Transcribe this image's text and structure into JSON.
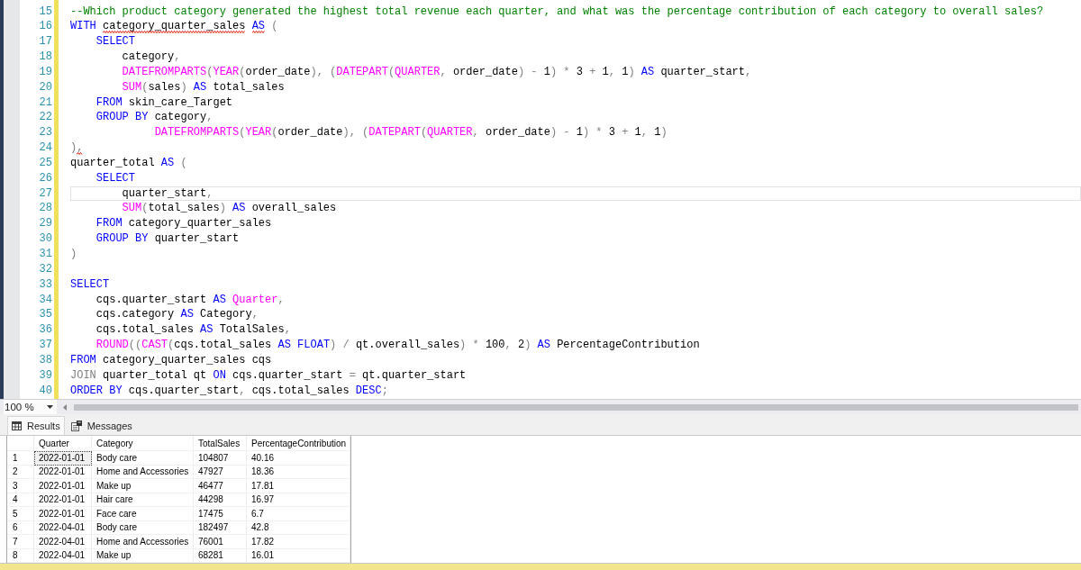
{
  "editor": {
    "lines": [
      {
        "number": "15",
        "current": false,
        "tokens": [
          {
            "kind": "comment",
            "text": "--Which product category generated the highest total revenue each quarter, and what was the percentage contribution of each category to overall sales?"
          }
        ]
      },
      {
        "number": "16",
        "current": false,
        "tokens": [
          {
            "kind": "keyword",
            "text": "WITH "
          },
          {
            "kind": "plain",
            "text": "category_quarter_sales ",
            "error": true
          },
          {
            "kind": "keyword",
            "text": "AS",
            "error": true
          },
          {
            "kind": "operator",
            "text": " ("
          }
        ]
      },
      {
        "number": "17",
        "current": false,
        "tokens": [
          {
            "kind": "keyword",
            "text": "    SELECT"
          }
        ]
      },
      {
        "number": "18",
        "current": false,
        "tokens": [
          {
            "kind": "plain",
            "text": "        category"
          },
          {
            "kind": "operator",
            "text": ","
          }
        ]
      },
      {
        "number": "19",
        "current": false,
        "tokens": [
          {
            "kind": "function",
            "text": "        DATEFROMPARTS"
          },
          {
            "kind": "operator",
            "text": "("
          },
          {
            "kind": "function",
            "text": "YEAR"
          },
          {
            "kind": "operator",
            "text": "("
          },
          {
            "kind": "plain",
            "text": "order_date"
          },
          {
            "kind": "operator",
            "text": "), ("
          },
          {
            "kind": "function",
            "text": "DATEPART"
          },
          {
            "kind": "operator",
            "text": "("
          },
          {
            "kind": "function",
            "text": "QUARTER"
          },
          {
            "kind": "operator",
            "text": ", "
          },
          {
            "kind": "plain",
            "text": "order_date"
          },
          {
            "kind": "operator",
            "text": ") - "
          },
          {
            "kind": "plain",
            "text": "1"
          },
          {
            "kind": "operator",
            "text": ") * "
          },
          {
            "kind": "plain",
            "text": "3"
          },
          {
            "kind": "operator",
            "text": " + "
          },
          {
            "kind": "plain",
            "text": "1"
          },
          {
            "kind": "operator",
            "text": ", "
          },
          {
            "kind": "plain",
            "text": "1"
          },
          {
            "kind": "operator",
            "text": ") "
          },
          {
            "kind": "keyword",
            "text": "AS "
          },
          {
            "kind": "plain",
            "text": "quarter_start"
          },
          {
            "kind": "operator",
            "text": ","
          }
        ]
      },
      {
        "number": "20",
        "current": false,
        "tokens": [
          {
            "kind": "function",
            "text": "        SUM"
          },
          {
            "kind": "operator",
            "text": "("
          },
          {
            "kind": "plain",
            "text": "sales"
          },
          {
            "kind": "operator",
            "text": ") "
          },
          {
            "kind": "keyword",
            "text": "AS "
          },
          {
            "kind": "plain",
            "text": "total_sales"
          }
        ]
      },
      {
        "number": "21",
        "current": false,
        "tokens": [
          {
            "kind": "keyword",
            "text": "    FROM "
          },
          {
            "kind": "plain",
            "text": "skin_care_Target"
          }
        ]
      },
      {
        "number": "22",
        "current": false,
        "tokens": [
          {
            "kind": "keyword",
            "text": "    GROUP BY "
          },
          {
            "kind": "plain",
            "text": "category"
          },
          {
            "kind": "operator",
            "text": ","
          }
        ]
      },
      {
        "number": "23",
        "current": false,
        "tokens": [
          {
            "kind": "function",
            "text": "             DATEFROMPARTS"
          },
          {
            "kind": "operator",
            "text": "("
          },
          {
            "kind": "function",
            "text": "YEAR"
          },
          {
            "kind": "operator",
            "text": "("
          },
          {
            "kind": "plain",
            "text": "order_date"
          },
          {
            "kind": "operator",
            "text": "), ("
          },
          {
            "kind": "function",
            "text": "DATEPART"
          },
          {
            "kind": "operator",
            "text": "("
          },
          {
            "kind": "function",
            "text": "QUARTER"
          },
          {
            "kind": "operator",
            "text": ", "
          },
          {
            "kind": "plain",
            "text": "order_date"
          },
          {
            "kind": "operator",
            "text": ") - "
          },
          {
            "kind": "plain",
            "text": "1"
          },
          {
            "kind": "operator",
            "text": ") * "
          },
          {
            "kind": "plain",
            "text": "3"
          },
          {
            "kind": "operator",
            "text": " + "
          },
          {
            "kind": "plain",
            "text": "1"
          },
          {
            "kind": "operator",
            "text": ", "
          },
          {
            "kind": "plain",
            "text": "1"
          },
          {
            "kind": "operator",
            "text": ")"
          }
        ]
      },
      {
        "number": "24",
        "current": false,
        "tokens": [
          {
            "kind": "operator",
            "text": ")"
          },
          {
            "kind": "operator",
            "text": ",",
            "error": true
          }
        ]
      },
      {
        "number": "25",
        "current": false,
        "tokens": [
          {
            "kind": "plain",
            "text": "quarter_total "
          },
          {
            "kind": "keyword",
            "text": "AS "
          },
          {
            "kind": "operator",
            "text": "("
          }
        ]
      },
      {
        "number": "26",
        "current": false,
        "tokens": [
          {
            "kind": "keyword",
            "text": "    SELECT"
          }
        ]
      },
      {
        "number": "27",
        "current": true,
        "tokens": [
          {
            "kind": "plain",
            "text": "        quarter_start"
          },
          {
            "kind": "operator",
            "text": ","
          }
        ]
      },
      {
        "number": "28",
        "current": false,
        "tokens": [
          {
            "kind": "function",
            "text": "        SUM"
          },
          {
            "kind": "operator",
            "text": "("
          },
          {
            "kind": "plain",
            "text": "total_sales"
          },
          {
            "kind": "operator",
            "text": ") "
          },
          {
            "kind": "keyword",
            "text": "AS "
          },
          {
            "kind": "plain",
            "text": "overall_sales"
          }
        ]
      },
      {
        "number": "29",
        "current": false,
        "tokens": [
          {
            "kind": "keyword",
            "text": "    FROM "
          },
          {
            "kind": "plain",
            "text": "category_quarter_sales"
          }
        ]
      },
      {
        "number": "30",
        "current": false,
        "tokens": [
          {
            "kind": "keyword",
            "text": "    GROUP BY "
          },
          {
            "kind": "plain",
            "text": "quarter_start"
          }
        ]
      },
      {
        "number": "31",
        "current": false,
        "tokens": [
          {
            "kind": "operator",
            "text": ")"
          }
        ]
      },
      {
        "number": "32",
        "current": false
      },
      {
        "number": "33",
        "current": false,
        "tokens": [
          {
            "kind": "keyword",
            "text": "SELECT"
          }
        ]
      },
      {
        "number": "34",
        "current": false,
        "tokens": [
          {
            "kind": "plain",
            "text": "    cqs.quarter_start "
          },
          {
            "kind": "keyword",
            "text": "AS "
          },
          {
            "kind": "function",
            "text": "Quarter"
          },
          {
            "kind": "operator",
            "text": ","
          }
        ]
      },
      {
        "number": "35",
        "current": false,
        "tokens": [
          {
            "kind": "plain",
            "text": "    cqs.category "
          },
          {
            "kind": "keyword",
            "text": "AS "
          },
          {
            "kind": "plain",
            "text": "Category"
          },
          {
            "kind": "operator",
            "text": ","
          }
        ]
      },
      {
        "number": "36",
        "current": false,
        "tokens": [
          {
            "kind": "plain",
            "text": "    cqs.total_sales "
          },
          {
            "kind": "keyword",
            "text": "AS "
          },
          {
            "kind": "plain",
            "text": "TotalSales"
          },
          {
            "kind": "operator",
            "text": ","
          }
        ]
      },
      {
        "number": "37",
        "current": false,
        "tokens": [
          {
            "kind": "function",
            "text": "    ROUND"
          },
          {
            "kind": "operator",
            "text": "(("
          },
          {
            "kind": "function",
            "text": "CAST"
          },
          {
            "kind": "operator",
            "text": "("
          },
          {
            "kind": "plain",
            "text": "cqs.total_sales "
          },
          {
            "kind": "keyword",
            "text": "AS FLOAT"
          },
          {
            "kind": "operator",
            "text": ") / "
          },
          {
            "kind": "plain",
            "text": "qt.overall_sales"
          },
          {
            "kind": "operator",
            "text": ") * "
          },
          {
            "kind": "plain",
            "text": "100"
          },
          {
            "kind": "operator",
            "text": ", "
          },
          {
            "kind": "plain",
            "text": "2"
          },
          {
            "kind": "operator",
            "text": ") "
          },
          {
            "kind": "keyword",
            "text": "AS "
          },
          {
            "kind": "plain",
            "text": "PercentageContribution"
          }
        ]
      },
      {
        "number": "38",
        "current": false,
        "tokens": [
          {
            "kind": "keyword",
            "text": "FROM "
          },
          {
            "kind": "plain",
            "text": "category_quarter_sales cqs"
          }
        ]
      },
      {
        "number": "39",
        "current": false,
        "tokens": [
          {
            "kind": "operator",
            "text": "JOIN "
          },
          {
            "kind": "plain",
            "text": "quarter_total qt "
          },
          {
            "kind": "keyword",
            "text": "ON "
          },
          {
            "kind": "plain",
            "text": "cqs.quarter_start "
          },
          {
            "kind": "operator",
            "text": "= "
          },
          {
            "kind": "plain",
            "text": "qt.quarter_start"
          }
        ]
      },
      {
        "number": "40",
        "current": false,
        "tokens": [
          {
            "kind": "keyword",
            "text": "ORDER BY "
          },
          {
            "kind": "plain",
            "text": "cqs.quarter_start"
          },
          {
            "kind": "operator",
            "text": ", "
          },
          {
            "kind": "plain",
            "text": "cqs.total_sales "
          },
          {
            "kind": "keyword",
            "text": "DESC"
          },
          {
            "kind": "operator",
            "text": ";"
          }
        ]
      }
    ]
  },
  "zoom": {
    "value": "100 %"
  },
  "result_tabs": [
    {
      "label": "Results",
      "selected": true
    },
    {
      "label": "Messages",
      "selected": false
    }
  ],
  "results_grid": {
    "columns": [
      "Quarter",
      "Category",
      "TotalSales",
      "PercentageContribution"
    ],
    "rows": [
      {
        "number": "1",
        "selected": true,
        "cells": [
          "2022-01-01",
          "Body care",
          "104807",
          "40.16"
        ]
      },
      {
        "number": "2",
        "selected": false,
        "cells": [
          "2022-01-01",
          "Home and Accessories",
          "47927",
          "18.36"
        ]
      },
      {
        "number": "3",
        "selected": false,
        "cells": [
          "2022-01-01",
          "Make up",
          "46477",
          "17.81"
        ]
      },
      {
        "number": "4",
        "selected": false,
        "cells": [
          "2022-01-01",
          "Hair care",
          "44298",
          "16.97"
        ]
      },
      {
        "number": "5",
        "selected": false,
        "cells": [
          "2022-01-01",
          "Face care",
          "17475",
          "6.7"
        ]
      },
      {
        "number": "6",
        "selected": false,
        "cells": [
          "2022-04-01",
          "Body care",
          "182497",
          "42.8"
        ]
      },
      {
        "number": "7",
        "selected": false,
        "cells": [
          "2022-04-01",
          "Home and Accessories",
          "76001",
          "17.82"
        ]
      },
      {
        "number": "8",
        "selected": false,
        "cells": [
          "2022-04-01",
          "Make up",
          "68281",
          "16.01"
        ]
      }
    ]
  }
}
